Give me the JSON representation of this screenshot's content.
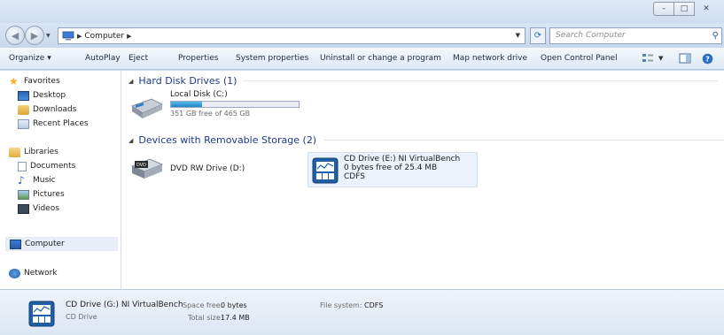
{
  "window": {
    "min_label": "–",
    "max_label": "□",
    "close_label": "✕"
  },
  "address": {
    "back_label": "◀",
    "forward_label": "▶",
    "breadcrumb": [
      "Computer"
    ],
    "search_placeholder": "Search Computer"
  },
  "toolbar": {
    "items": [
      "Organize",
      "AutoPlay",
      "Eject",
      "Properties",
      "System properties",
      "Uninstall or change a program",
      "Map network drive",
      "Open Control Panel"
    ]
  },
  "nav": {
    "favorites": "Favorites",
    "desktop": "Desktop",
    "downloads": "Downloads",
    "recent": "Recent Places",
    "libraries": "Libraries",
    "documents": "Documents",
    "music": "Music",
    "pictures": "Pictures",
    "videos": "Videos",
    "computer": "Computer",
    "network": "Network"
  },
  "groups": {
    "hdd": "Hard Disk Drives (1)",
    "removable": "Devices with Removable Storage (2)"
  },
  "drives": {
    "local": {
      "name": "Local Disk (C:)",
      "free": "351 GB free of 465 GB",
      "used_fraction": 0.245
    },
    "dvd": {
      "name": "DVD RW Drive (D:)",
      "badge": "DVD"
    },
    "cd": {
      "name": "CD Drive (E:) NI VirtualBench",
      "free": "0 bytes free of 25.4 MB",
      "fs": "CDFS"
    }
  },
  "details": {
    "name": "CD Drive (G:) NI VirtualBench",
    "type": "CD Drive",
    "space_free_label": "Space free:",
    "space_free": "0 bytes",
    "total_label": "Total size:",
    "total": "17.4 MB",
    "fs_label": "File system:",
    "fs": "CDFS"
  },
  "colors": {
    "accent": "#1e3a8c",
    "bar_fill": "#2386c8",
    "chrome": "#c9d9ec"
  }
}
